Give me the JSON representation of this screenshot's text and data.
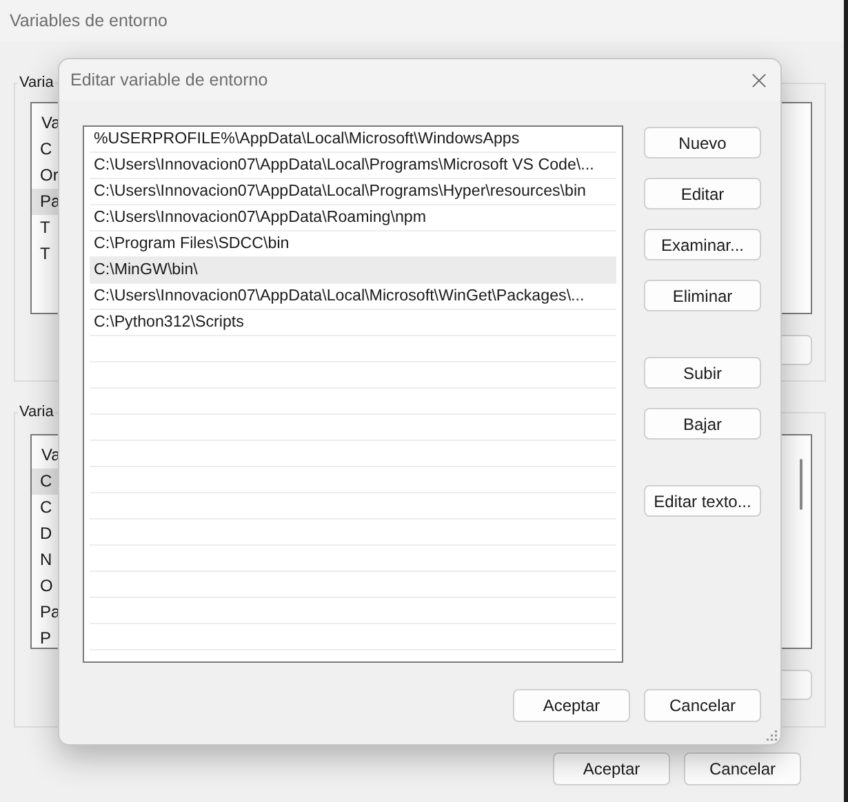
{
  "window": {
    "title": "Variables de entorno"
  },
  "user_variables": {
    "label": "Varia",
    "header": "Va",
    "rows": [
      {
        "text": "C",
        "selected": false
      },
      {
        "text": "Or",
        "selected": false
      },
      {
        "text": "Pa",
        "selected": true
      },
      {
        "text": "T",
        "selected": false
      },
      {
        "text": "T",
        "selected": false
      }
    ]
  },
  "system_variables": {
    "label": "Varia",
    "header": "Va",
    "rows": [
      {
        "text": "C",
        "selected": true
      },
      {
        "text": "C",
        "selected": false
      },
      {
        "text": "D",
        "selected": false
      },
      {
        "text": "N",
        "selected": false
      },
      {
        "text": "O",
        "selected": false
      },
      {
        "text": "Pa",
        "selected": false
      },
      {
        "text": "P",
        "selected": false
      }
    ]
  },
  "buttons": [
    "Aceptar",
    "Cancelar"
  ],
  "dialog": {
    "title": "Editar variable de entorno",
    "entries": [
      {
        "text": "%USERPROFILE%\\AppData\\Local\\Microsoft\\WindowsApps",
        "selected": false
      },
      {
        "text": "C:\\Users\\Innovacion07\\AppData\\Local\\Programs\\Microsoft VS Code\\...",
        "selected": false
      },
      {
        "text": "C:\\Users\\Innovacion07\\AppData\\Local\\Programs\\Hyper\\resources\\bin",
        "selected": false
      },
      {
        "text": "C:\\Users\\Innovacion07\\AppData\\Roaming\\npm",
        "selected": false
      },
      {
        "text": "C:\\Program Files\\SDCC\\bin",
        "selected": false
      },
      {
        "text": "C:\\MinGW\\bin\\",
        "selected": true
      },
      {
        "text": "C:\\Users\\Innovacion07\\AppData\\Local\\Microsoft\\WinGet\\Packages\\...",
        "selected": false
      },
      {
        "text": "C:\\Python312\\Scripts",
        "selected": false
      }
    ],
    "side_button_groups": [
      [
        "Nuevo",
        "Editar",
        "Examinar...",
        "Eliminar"
      ],
      [
        "Subir",
        "Bajar"
      ],
      [
        "Editar texto..."
      ]
    ],
    "buttons": [
      "Aceptar",
      "Cancelar"
    ]
  }
}
